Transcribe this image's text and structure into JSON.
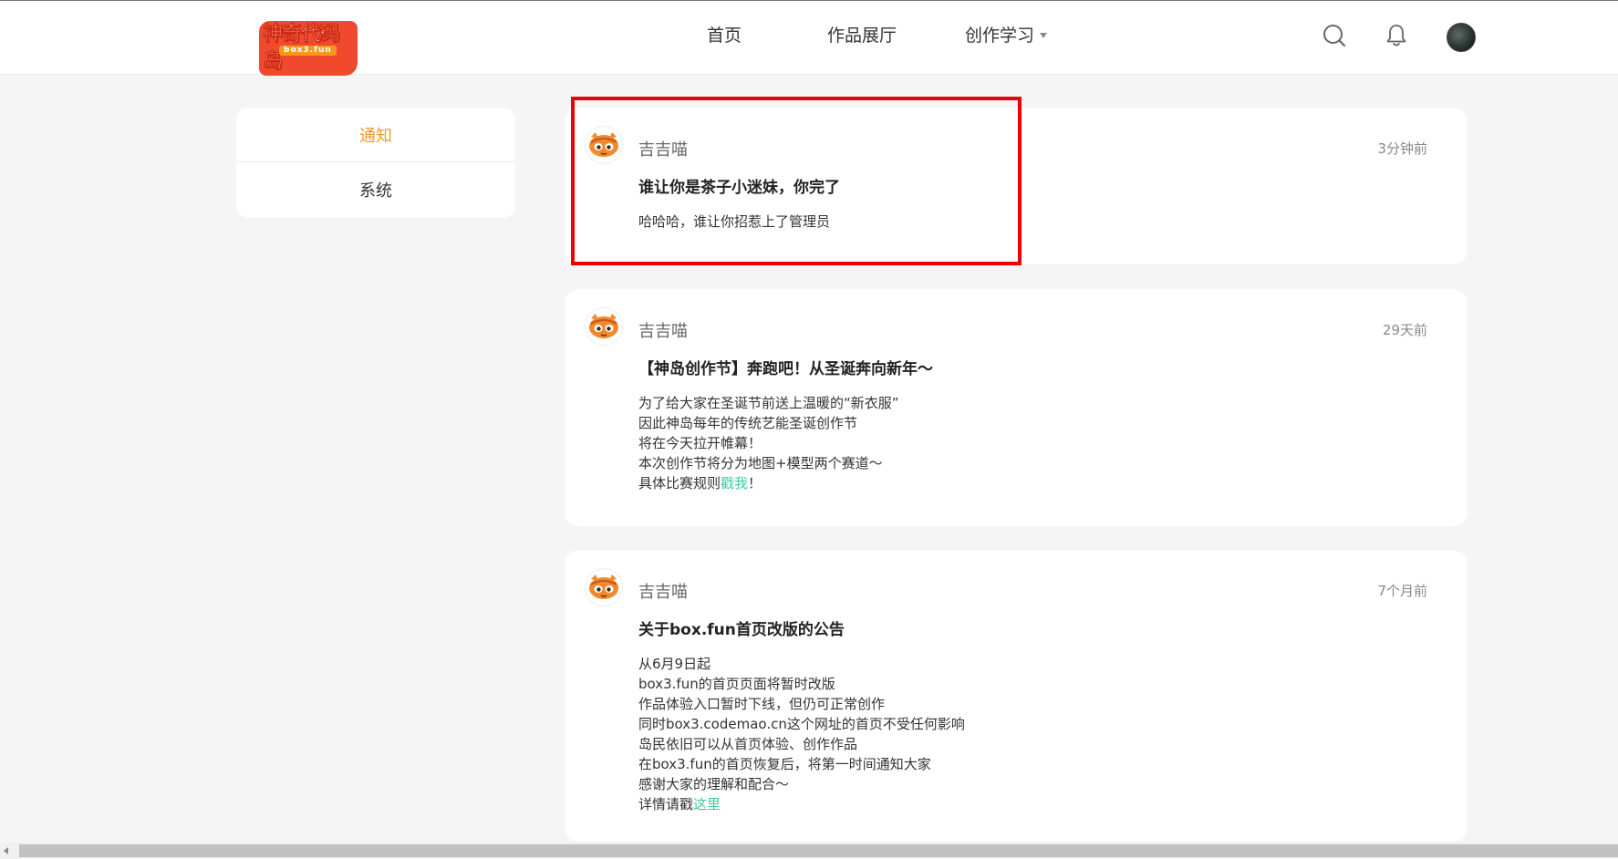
{
  "header": {
    "logo_text": "神奇代码岛",
    "logo_sub": "box3.fun",
    "nav": [
      {
        "label": "首页"
      },
      {
        "label": "作品展厅"
      },
      {
        "label": "创作学习"
      }
    ]
  },
  "sidebar": {
    "items": [
      {
        "label": "通知",
        "active": true
      },
      {
        "label": "系统",
        "active": false
      }
    ]
  },
  "notifications": [
    {
      "author": "吉吉喵",
      "time": "3分钟前",
      "title": "谁让你是茶子小迷妹，你完了",
      "lines": [
        "哈哈哈，谁让你招惹上了管理员"
      ]
    },
    {
      "author": "吉吉喵",
      "time": "29天前",
      "title": "【神岛创作节】奔跑吧！从圣诞奔向新年～",
      "lines": [
        "为了给大家在圣诞节前送上温暖的“新衣服”",
        "因此神岛每年的传统艺能圣诞创作节",
        "将在今天拉开帷幕！",
        "本次创作节将分为地图+模型两个赛道～"
      ],
      "last_line_prefix": "具体比赛规则",
      "last_line_link": "戳我",
      "last_line_suffix": "！"
    },
    {
      "author": "吉吉喵",
      "time": "7个月前",
      "title": "关于box.fun首页改版的公告",
      "lines": [
        "从6月9日起",
        "box3.fun的首页页面将暂时改版",
        "作品体验入口暂时下线，但仍可正常创作",
        "同时box3.codemao.cn这个网址的首页不受任何影响",
        "岛民依旧可以从首页体验、创作作品",
        "在box3.fun的首页恢复后，将第一时间通知大家",
        "感谢大家的理解和配合～"
      ],
      "last_line_prefix": "详情请戳",
      "last_line_link": "这里",
      "last_line_suffix": ""
    }
  ],
  "icons": {
    "search": "search-icon",
    "bell": "bell-icon",
    "avatar": "user-avatar"
  },
  "colors": {
    "accent": "#f5962a",
    "link": "#3fcaa0",
    "highlight": "#ee0000"
  }
}
